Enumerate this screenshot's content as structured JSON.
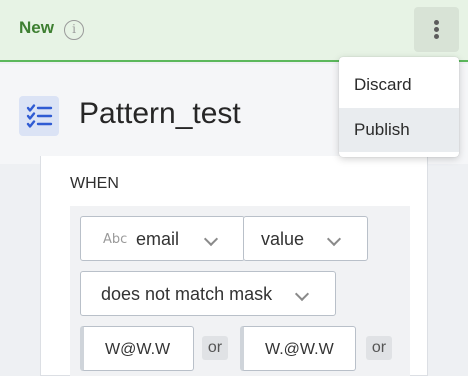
{
  "header": {
    "status_label": "New",
    "info_icon": "info-icon",
    "more_icon": "more-vertical-icon"
  },
  "title": {
    "icon": "checklist-icon",
    "text": "Pattern_test"
  },
  "rule": {
    "when_label": "WHEN",
    "field_type_badge": "Abc",
    "field_select": "email",
    "property_select": "value",
    "operator_select": "does not match mask",
    "masks": [
      "W@W.W",
      "W.@W.W"
    ],
    "or_label": "or"
  },
  "menu": {
    "items": [
      {
        "label": "Discard",
        "active": false
      },
      {
        "label": "Publish",
        "active": true
      }
    ]
  },
  "colors": {
    "header_bg": "#e7f3e5",
    "status_text": "#3e7f31",
    "accent_line": "#5cb85c",
    "icon_blue": "#2f5bd3"
  }
}
